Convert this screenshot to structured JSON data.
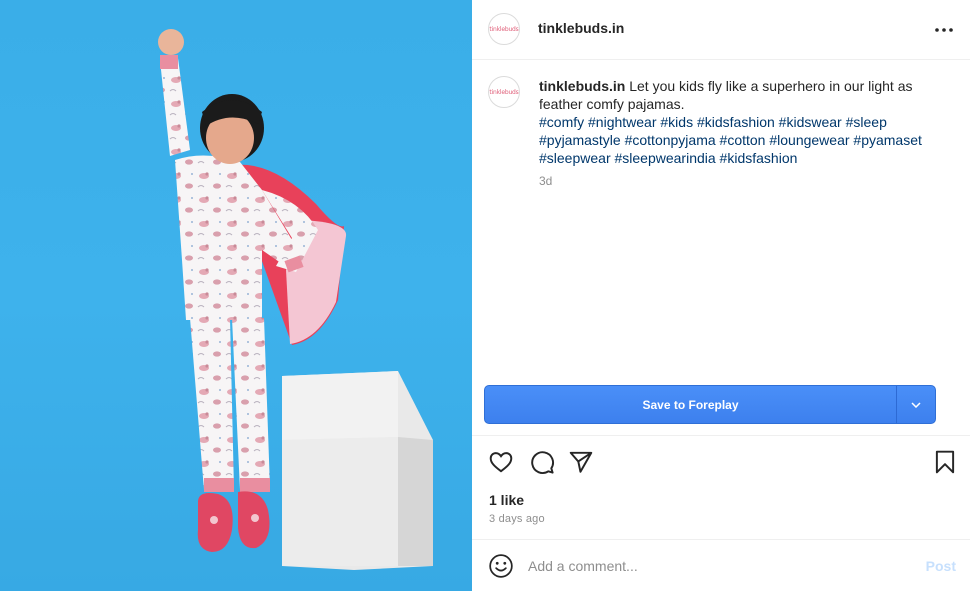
{
  "post": {
    "username": "tinklebuds.in",
    "avatar_text": "tinklebuds",
    "caption": {
      "username": "tinklebuds.in",
      "text": "Let you kids fly like a superhero in our light as feather comfy pajamas.",
      "hashtags": "#comfy #nightwear #kids #kidsfashion #kidswear #sleep #pyjamastyle #cottonpyjama #cotton #loungewear #pyamaset #sleepwear #sleepwearindia #kidsfashion",
      "age": "3d"
    },
    "save_button": {
      "label": "Save to Foreplay",
      "dropdown_icon": "chevron-down-icon"
    },
    "likes": "1 like",
    "date": "3 days ago",
    "comment": {
      "placeholder": "Add a comment...",
      "post_label": "Post"
    }
  },
  "icons": [
    "more-options-icon",
    "heart-icon",
    "comment-icon",
    "share-icon",
    "bookmark-icon",
    "emoji-icon"
  ],
  "colors": {
    "image_background": "#3eb2ec",
    "save_button": "#4287f5",
    "hashtag_link": "#00376b",
    "post_disabled": "#c7e0fd",
    "cape": "#e8415a"
  }
}
